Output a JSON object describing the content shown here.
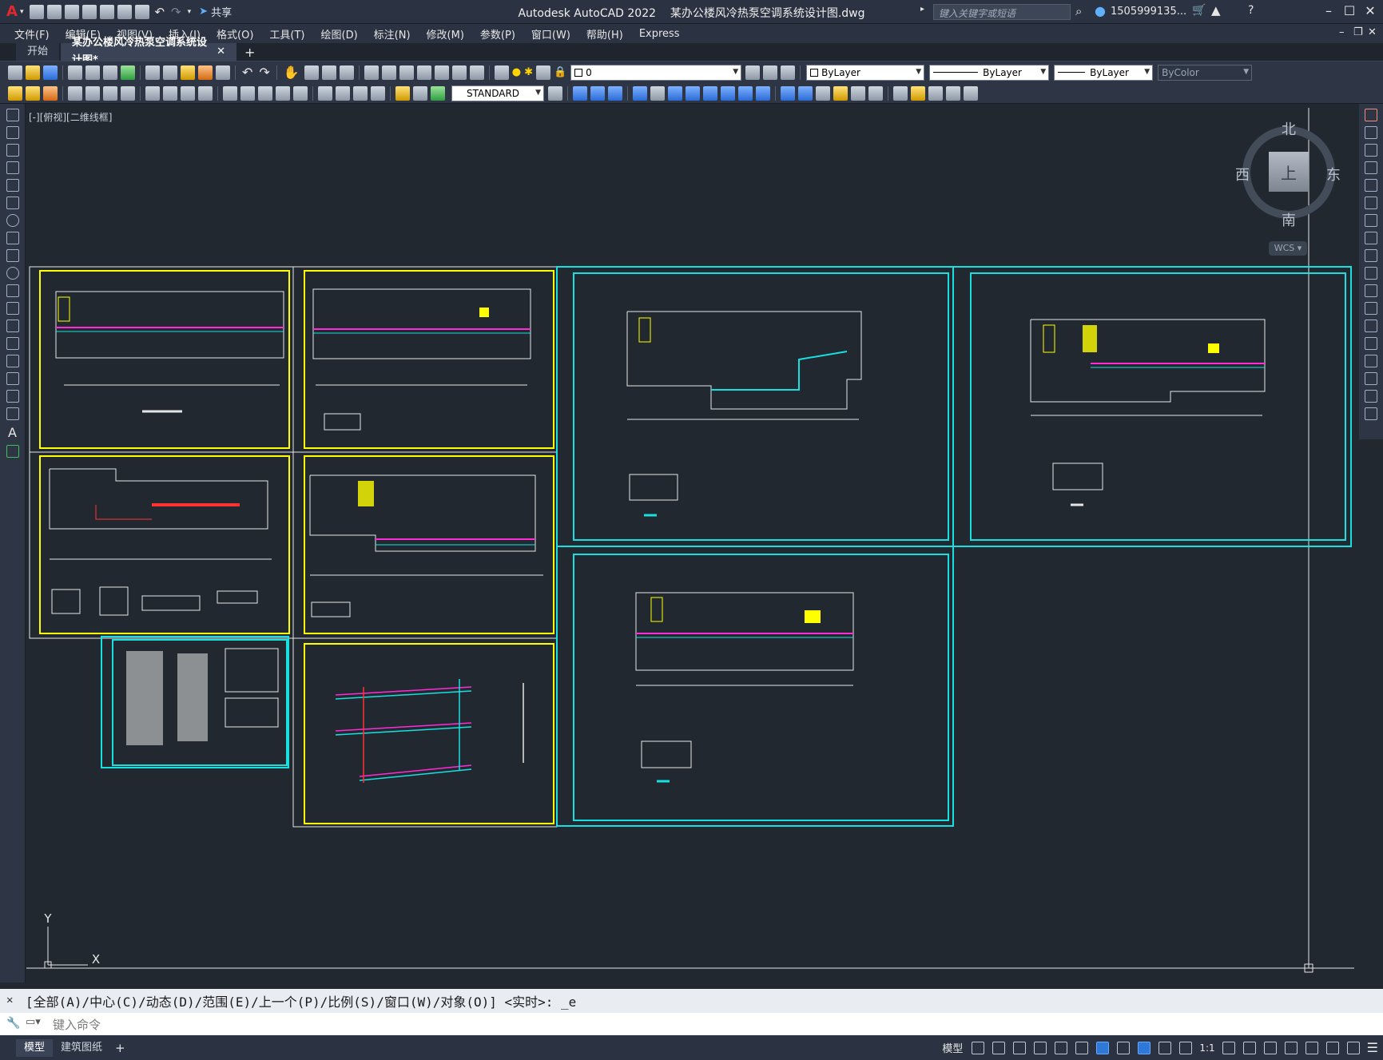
{
  "app": {
    "title": "Autodesk AutoCAD 2022",
    "filename": "某办公楼风冷热泵空调系统设计图.dwg",
    "search_placeholder": "键入关键字或短语",
    "user": "1505999135...",
    "share": "共享"
  },
  "menu": [
    "文件(F)",
    "编辑(E)",
    "视图(V)",
    "插入(I)",
    "格式(O)",
    "工具(T)",
    "绘图(D)",
    "标注(N)",
    "修改(M)",
    "参数(P)",
    "窗口(W)",
    "帮助(H)",
    "Express"
  ],
  "tabs": {
    "start": "开始",
    "drawing": "某办公楼风冷热泵空调系统设计图*"
  },
  "toolbar": {
    "layer_value": "0",
    "text_style": "STANDARD",
    "color": "ByLayer",
    "linetype": "ByLayer",
    "lineweight": "ByLayer",
    "plotstyle": "ByColor"
  },
  "viewport": {
    "label": "[-][俯视][二维线框]",
    "compass_n": "北",
    "compass_s": "南",
    "compass_e": "东",
    "compass_w": "西",
    "cube_face": "上",
    "wcs": "WCS",
    "axis_x": "X",
    "axis_y": "Y"
  },
  "command": {
    "history": "[全部(A)/中心(C)/动态(D)/范围(E)/上一个(P)/比例(S)/窗口(W)/对象(O)] <实时>: _e",
    "placeholder": "键入命令"
  },
  "status": {
    "model_tab": "模型",
    "layout_tab": "建筑图纸",
    "model_label": "模型",
    "scale": "1:1"
  },
  "colors": {
    "bg": "#212830",
    "yellow_frame": "#ffff00",
    "cyan_frame": "#19e0e0",
    "white_frame": "#e6e6e6"
  }
}
